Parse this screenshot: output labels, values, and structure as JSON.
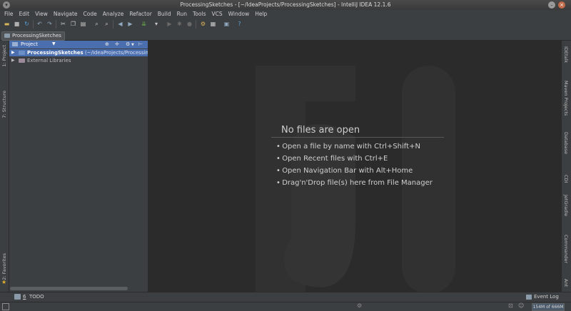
{
  "window": {
    "title": "ProcessingSketches - [~/IdeaProjects/ProcessingSketches] - IntelliJ IDEA 12.1.6"
  },
  "menu": [
    "File",
    "Edit",
    "View",
    "Navigate",
    "Code",
    "Analyze",
    "Refactor",
    "Build",
    "Run",
    "Tools",
    "VCS",
    "Window",
    "Help"
  ],
  "breadcrumb": {
    "label": "ProcessingSketches"
  },
  "left_tabs": {
    "project": "1: Project",
    "structure": "7: Structure",
    "favorites": "2: Favorites"
  },
  "project_panel": {
    "view_label": "Project",
    "tree": [
      {
        "name": "ProcessingSketches",
        "path": "(~/IdeaProjects/Processing",
        "selected": true
      },
      {
        "name": "External Libraries",
        "path": "",
        "selected": false
      }
    ]
  },
  "editor": {
    "empty_title": "No files are open",
    "hints": [
      "Open a file by name with Ctrl+Shift+N",
      "Open Recent files with Ctrl+E",
      "Open Navigation Bar with Alt+Home",
      "Drag'n'Drop file(s) here from File Manager"
    ]
  },
  "right_tabs": [
    "IDEtalk",
    "Maven Projects",
    "Database",
    "CDI",
    "JetGradle",
    "Commander",
    "Ant"
  ],
  "bottom": {
    "todo_number": "6",
    "todo_label": "TODO",
    "event_log": "Event Log"
  },
  "status": {
    "memory": "154M of 666M"
  },
  "colors": {
    "selection": "#4b6eaf",
    "editor_bg": "#2b2b2b",
    "panel_bg": "#3c3f41",
    "folder": "#6a8fc7"
  }
}
